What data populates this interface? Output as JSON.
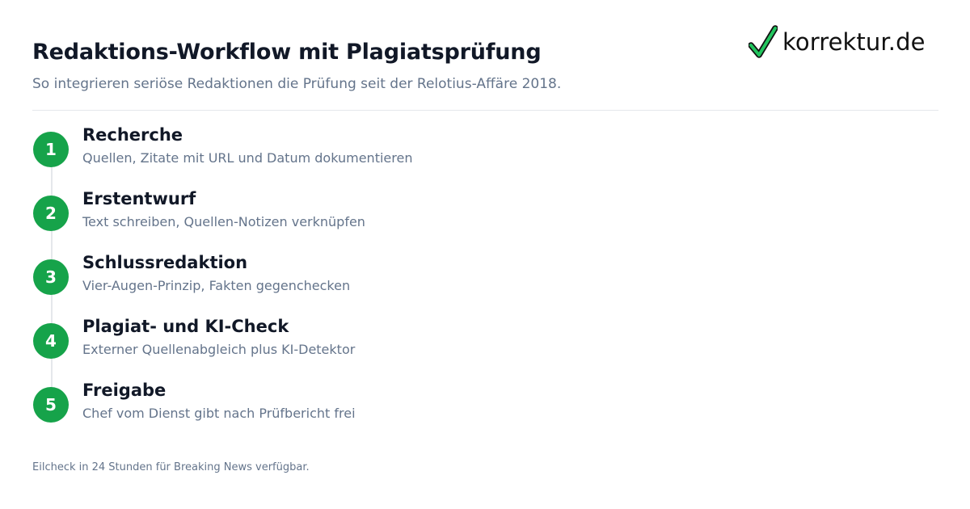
{
  "header": {
    "title": "Redaktions-Workflow mit Plagiatsprüfung",
    "subtitle": "So integrieren seriöse Redaktionen die Prüfung seit der Relotius-Affäre 2018."
  },
  "logo": {
    "text": "korrektur.de",
    "icon": "checkmark-icon",
    "icon_color": "#22c55e"
  },
  "colors": {
    "accent": "#16a34a",
    "title": "#111827",
    "muted": "#64748b",
    "divider": "#e5e7eb"
  },
  "steps": [
    {
      "number": "1",
      "title": "Recherche",
      "description": "Quellen, Zitate mit URL und Datum dokumentieren"
    },
    {
      "number": "2",
      "title": "Erstentwurf",
      "description": "Text schreiben, Quellen-Notizen verknüpfen"
    },
    {
      "number": "3",
      "title": "Schlussredaktion",
      "description": "Vier-Augen-Prinzip, Fakten gegenchecken"
    },
    {
      "number": "4",
      "title": "Plagiat- und KI-Check",
      "description": "Externer Quellenabgleich plus KI-Detektor"
    },
    {
      "number": "5",
      "title": "Freigabe",
      "description": "Chef vom Dienst gibt nach Prüfbericht frei"
    }
  ],
  "footnote": "Eilcheck in 24 Stunden für Breaking News verfügbar."
}
